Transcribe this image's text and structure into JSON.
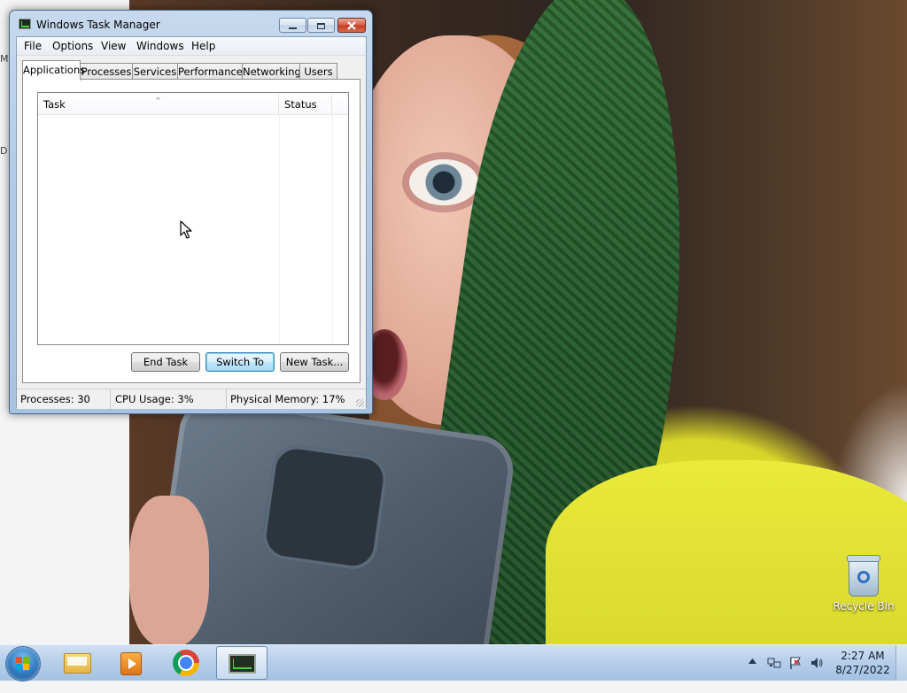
{
  "window": {
    "title": "Windows Task Manager",
    "menu": [
      "File",
      "Options",
      "View",
      "Windows",
      "Help"
    ],
    "tabs": [
      "Applications",
      "Processes",
      "Services",
      "Performance",
      "Networking",
      "Users"
    ],
    "active_tab": "Applications",
    "columns": [
      "Task",
      "Status"
    ],
    "buttons": {
      "end_task": "End Task",
      "switch_to": "Switch To",
      "new_task": "New Task..."
    },
    "status": {
      "processes": "Processes: 30",
      "cpu": "CPU Usage: 3%",
      "memory": "Physical Memory: 17%"
    }
  },
  "desktop": {
    "recycle_bin": "Recycle Bin",
    "edge_letters": [
      "M",
      "D"
    ]
  },
  "taskbar": {
    "pinned": [
      "windows-explorer-icon",
      "media-player-icon",
      "chrome-icon",
      "task-manager-icon"
    ],
    "clock_time": "2:27 AM",
    "clock_date": "8/27/2022"
  },
  "colors": {
    "titlebar": "#b3cbe6",
    "taskbar": "#b7cfe9",
    "close_button": "#c43b22"
  }
}
